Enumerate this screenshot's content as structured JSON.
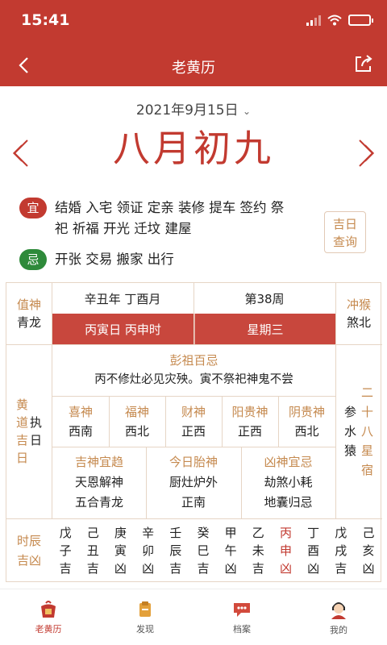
{
  "status": {
    "time": "15:41"
  },
  "header": {
    "title": "老黄历"
  },
  "date": {
    "solar": "2021年9月15日",
    "lunar": "八月初九"
  },
  "yi": {
    "label": "宜",
    "line1": "结婚 入宅 领证 定亲 装修 提车 签约 祭",
    "line2": "祀 祈福 开光 迁坟 建屋"
  },
  "ji": {
    "label": "忌",
    "text": "开张 交易 搬家 出行"
  },
  "jiri": {
    "line1": "吉日",
    "line2": "查询"
  },
  "info": {
    "zhishen_label": "值神",
    "zhishen_value": "青龙",
    "year_month": "辛丑年 丁酉月",
    "week_no": "第38周",
    "day_hour": "丙寅日 丙申时",
    "weekday": "星期三",
    "chong_label": "冲猴",
    "chong_value": "煞北",
    "huangdao": [
      "黄",
      "道",
      "吉",
      "日"
    ],
    "zhi": [
      "执",
      "日"
    ],
    "pengzu_title": "彭祖百忌",
    "pengzu_text": "丙不修灶必见灾殃。寅不祭祀神鬼不尝",
    "gods": [
      {
        "label": "喜神",
        "value": "西南"
      },
      {
        "label": "福神",
        "value": "西北"
      },
      {
        "label": "财神",
        "value": "正西"
      },
      {
        "label": "阳贵神",
        "value": "正西"
      },
      {
        "label": "阴贵神",
        "value": "西北"
      }
    ],
    "jishen_title": "吉神宜趋",
    "jishen_1": "天恩解神",
    "jishen_2": "五合青龙",
    "taishen_title": "今日胎神",
    "taishen_1": "厨灶炉外",
    "taishen_2": "正南",
    "xiongshen_title": "凶神宜忌",
    "xiongshen_1": "劫煞小耗",
    "xiongshen_2": "地囊归忌",
    "xiu_left": [
      "参",
      "水",
      "猿"
    ],
    "xiu_right": [
      "二",
      "十",
      "八",
      "星",
      "宿"
    ],
    "shichen_label": [
      "时辰",
      "吉凶"
    ],
    "hours": [
      {
        "top": "戊",
        "mid": "子",
        "bot": "吉"
      },
      {
        "top": "己",
        "mid": "丑",
        "bot": "吉"
      },
      {
        "top": "庚",
        "mid": "寅",
        "bot": "凶"
      },
      {
        "top": "辛",
        "mid": "卯",
        "bot": "凶"
      },
      {
        "top": "壬",
        "mid": "辰",
        "bot": "吉"
      },
      {
        "top": "癸",
        "mid": "巳",
        "bot": "吉"
      },
      {
        "top": "甲",
        "mid": "午",
        "bot": "凶"
      },
      {
        "top": "乙",
        "mid": "未",
        "bot": "吉"
      },
      {
        "top": "丙",
        "mid": "申",
        "bot": "凶"
      },
      {
        "top": "丁",
        "mid": "酉",
        "bot": "凶"
      },
      {
        "top": "戊",
        "mid": "戌",
        "bot": "吉"
      },
      {
        "top": "己",
        "mid": "亥",
        "bot": "凶"
      }
    ],
    "current_hour_index": 8
  },
  "tabs": [
    {
      "label": "老黄历",
      "icon": "almanac-icon"
    },
    {
      "label": "发现",
      "icon": "discover-icon"
    },
    {
      "label": "档案",
      "icon": "archive-icon"
    },
    {
      "label": "我的",
      "icon": "profile-icon"
    }
  ],
  "colors": {
    "primary": "#c23a30",
    "accent": "#c5894e",
    "green": "#2e8a3a"
  }
}
